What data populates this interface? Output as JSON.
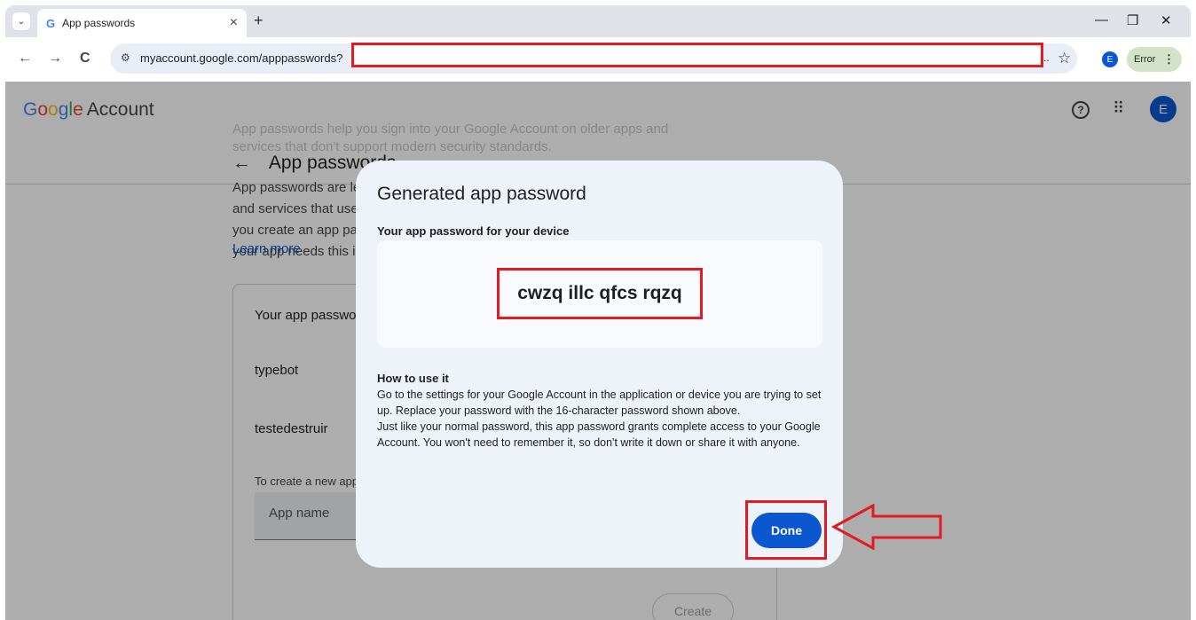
{
  "browser": {
    "tab_title": "App passwords",
    "tab_favicon": "G",
    "tab_close": "×",
    "new_tab": "+",
    "dropdown": "⌄",
    "url": "myaccount.google.com/apppasswords?",
    "url_ellipsis": "..",
    "bookmark_star": "☆",
    "profile_initial": "E",
    "error_label": "Error",
    "menu_glyph": "⋮",
    "nav": {
      "back": "←",
      "forward": "→",
      "reload": "C"
    },
    "window": {
      "minimize": "—",
      "restore": "❐",
      "close": "✕"
    }
  },
  "header": {
    "logo_letters": [
      "G",
      "o",
      "o",
      "g",
      "l",
      "e"
    ],
    "logo_suffix": "Account",
    "help": "?",
    "apps": "⠿",
    "avatar_initial": "E"
  },
  "page": {
    "ghost_text": "App passwords help you sign into your Google Account on older apps and services that don't support modern security standards.",
    "back_arrow": "←",
    "title": "App passwords",
    "intro": "App passwords are less secure than using up-to-date apps and services that use modern security standards. Before you create an app password, you should check to see if your app needs this in order to sign in.",
    "learn_more": "Learn more",
    "card": {
      "title": "Your app passwords",
      "apps": [
        "typebot",
        "testedestruir"
      ],
      "create_hint": "To create a new app specific password, type a name for it below...",
      "input_placeholder": "App name",
      "create_button": "Create"
    }
  },
  "dialog": {
    "title": "Generated app password",
    "subtitle": "Your app password for your device",
    "password": "cwzq illc qfcs rqzq",
    "how_title": "How to use it",
    "how_body_1": "Go to the settings for your Google Account in the application or device you are trying to set up. Replace your password with the 16-character password shown above.",
    "how_body_2": "Just like your normal password, this app password grants complete access to your Google Account. You won't need to remember it, so don't write it down or share it with anyone.",
    "done_button": "Done"
  },
  "colors": {
    "annotation_red": "#e01b24",
    "primary_blue": "#0b57d0",
    "dialog_bg": "#eef2f9"
  }
}
